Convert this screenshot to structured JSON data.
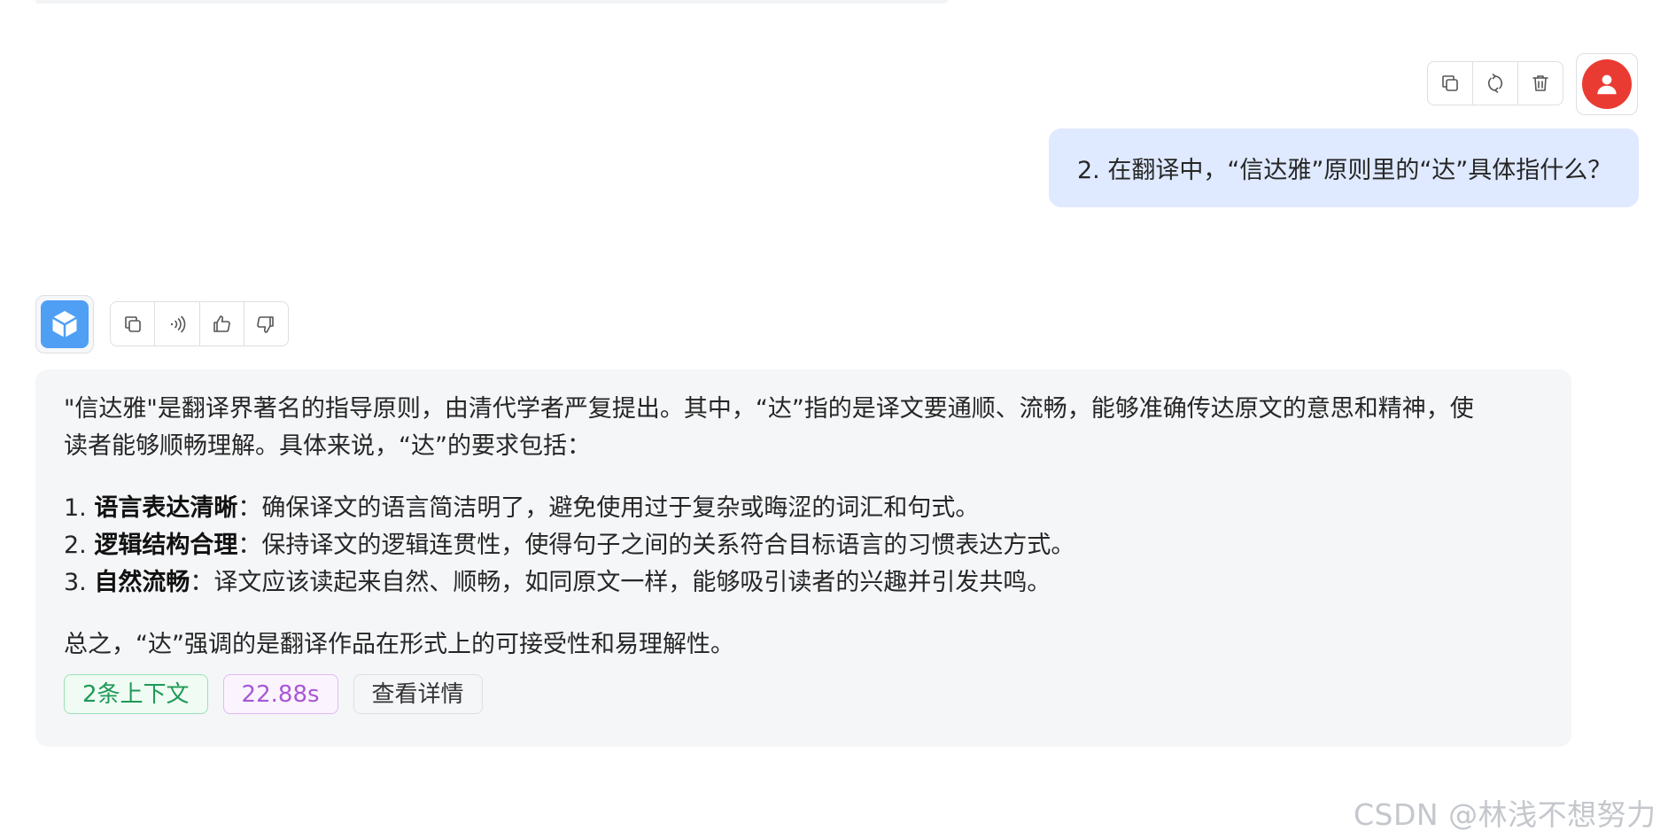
{
  "user_message": {
    "text": "2. 在翻译中，“信达雅”原则里的“达”具体指什么？",
    "toolbar": {
      "copy_icon": "copy-icon",
      "regenerate_icon": "refresh-icon",
      "delete_icon": "trash-icon"
    },
    "avatar_icon": "user-icon",
    "avatar_color": "#ea3b33",
    "bubble_color": "#dfe9ff"
  },
  "assistant_message": {
    "avatar_icon": "cube-icon",
    "avatar_color": "#4f9ff5",
    "toolbar": {
      "copy_icon": "copy-icon",
      "speak_icon": "speaker-icon",
      "like_icon": "thumbs-up-icon",
      "dislike_icon": "thumbs-down-icon"
    },
    "intro_line1": "\"信达雅\"是翻译界著名的指导原则，由清代学者严复提出。其中，“达”指的是译文要通顺、流畅，能够准确传达原文的意思和精神，使",
    "intro_line2": "读者能够顺畅理解。具体来说，“达”的要求包括：",
    "items": [
      {
        "num": "1. ",
        "title": "语言表达清晰",
        "desc": "：确保译文的语言简洁明了，避免使用过于复杂或晦涩的词汇和句式。"
      },
      {
        "num": "2. ",
        "title": "逻辑结构合理",
        "desc": "：保持译文的逻辑连贯性，使得句子之间的关系符合目标语言的习惯表达方式。"
      },
      {
        "num": "3. ",
        "title": "自然流畅",
        "desc": "：译文应该读起来自然、顺畅，如同原文一样，能够吸引读者的兴趣并引发共鸣。"
      }
    ],
    "summary": "总之，“达”强调的是翻译作品在形式上的可接受性和易理解性。",
    "chips": {
      "context": "2条上下文",
      "time": "22.88s",
      "detail": "查看详情"
    }
  },
  "watermark": "CSDN @林浅不想努力"
}
